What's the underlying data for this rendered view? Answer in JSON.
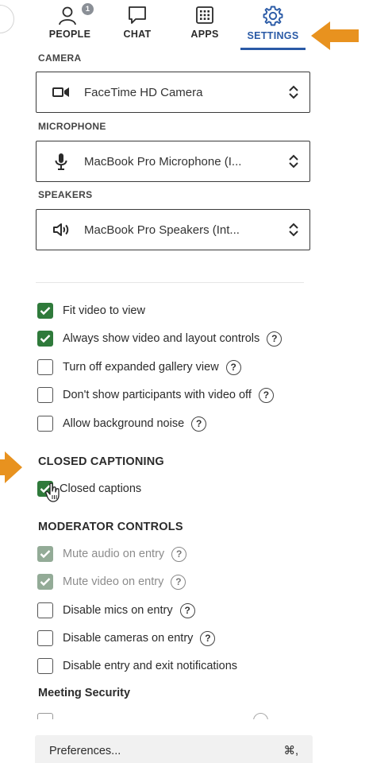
{
  "tabs": [
    {
      "id": "people",
      "label": "PEOPLE",
      "badge": "1",
      "icon": "people-icon"
    },
    {
      "id": "chat",
      "label": "CHAT",
      "icon": "chat-icon"
    },
    {
      "id": "apps",
      "label": "APPS",
      "icon": "apps-grid-icon"
    },
    {
      "id": "settings",
      "label": "SETTINGS",
      "icon": "gear-icon",
      "active": true
    }
  ],
  "devices": {
    "camera": {
      "label": "CAMERA",
      "value": "FaceTime HD Camera",
      "icon": "video-camera-icon"
    },
    "microphone": {
      "label": "MICROPHONE",
      "value": "MacBook Pro Microphone (I...",
      "icon": "microphone-icon"
    },
    "speakers": {
      "label": "SPEAKERS",
      "value": "MacBook Pro Speakers (Int...",
      "icon": "speaker-icon"
    }
  },
  "video_options": [
    {
      "label": "Fit video to view",
      "checked": true,
      "help": false
    },
    {
      "label": "Always show video and layout controls",
      "checked": true,
      "help": true
    },
    {
      "label": "Turn off expanded gallery view",
      "checked": false,
      "help": true
    },
    {
      "label": "Don't show participants with video off",
      "checked": false,
      "help": true
    },
    {
      "label": "Allow background noise",
      "checked": false,
      "help": true
    }
  ],
  "closed_captioning": {
    "heading": "CLOSED CAPTIONING",
    "item": {
      "label": "Closed captions",
      "checked": true
    }
  },
  "moderator": {
    "heading": "MODERATOR CONTROLS",
    "items": [
      {
        "label": "Mute audio on entry",
        "checked": true,
        "disabled": true,
        "help": true
      },
      {
        "label": "Mute video on entry",
        "checked": true,
        "disabled": true,
        "help": true
      },
      {
        "label": "Disable mics on entry",
        "checked": false,
        "help": true
      },
      {
        "label": "Disable cameras on entry",
        "checked": false,
        "help": true
      },
      {
        "label": "Disable entry and exit notifications",
        "checked": false,
        "help": false
      }
    ]
  },
  "security": {
    "heading": "Meeting Security"
  },
  "help_glyph": "?",
  "footer": {
    "preferences_label": "Preferences...",
    "shortcut": "⌘,"
  },
  "colors": {
    "accent": "#2a5aa6",
    "checked": "#2f7a3b",
    "annotation_arrow": "#e8921f"
  }
}
